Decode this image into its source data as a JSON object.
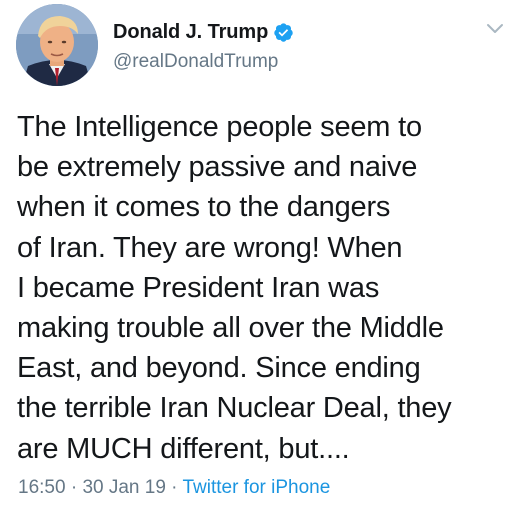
{
  "author": {
    "display_name": "Donald J. Trump",
    "handle": "@realDonaldTrump",
    "verified": true,
    "avatar_icon": "profile-photo"
  },
  "menu": {
    "icon": "chevron-down-icon"
  },
  "tweet": {
    "text": "The Intelligence people seem to\nbe extremely passive and naive\nwhen it comes to the dangers\nof Iran. They are wrong! When\nI became President Iran was\nmaking trouble all over the Middle\nEast, and beyond. Since ending\nthe terrible Iran Nuclear Deal, they\nare MUCH different, but....",
    "time": "16:50",
    "separator": " · ",
    "date": "30 Jan 19",
    "source": "Twitter for iPhone"
  },
  "colors": {
    "verified_blue": "#1da1f2",
    "link_blue": "#1b95e0",
    "secondary_gray": "#657786",
    "text": "#14171a"
  }
}
